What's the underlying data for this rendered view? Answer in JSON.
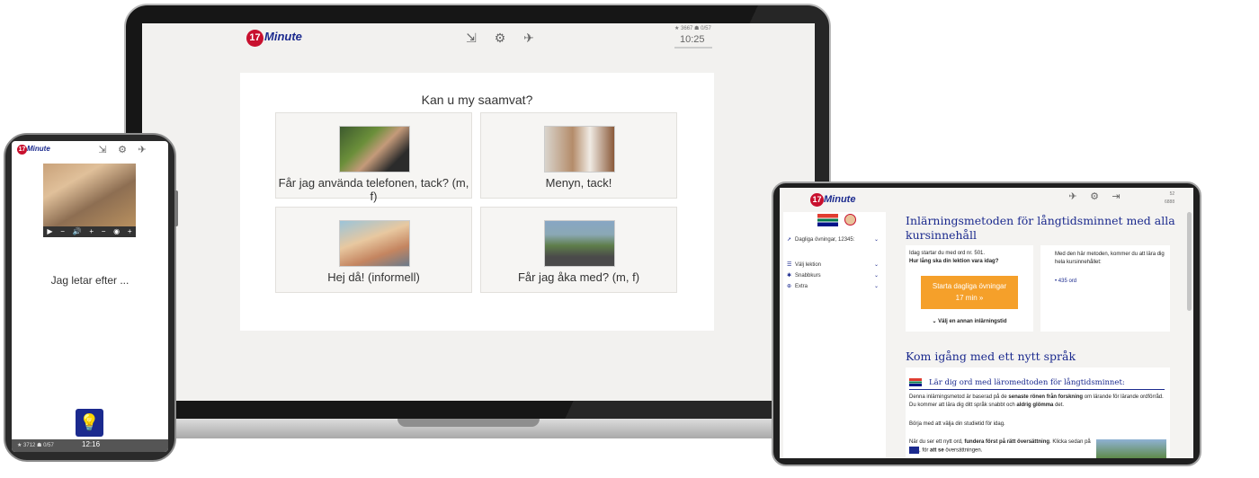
{
  "brand": {
    "logo_number": "17",
    "logo_text": "Minute"
  },
  "laptop": {
    "stats": "★ 3667 ☗ 0/57",
    "time": "10:25",
    "question": "Kan u my saamvat?",
    "options": [
      {
        "label": "Får jag använda telefonen, tack? (m, f)"
      },
      {
        "label": "Menyn, tack!"
      },
      {
        "label": "Hej då! (informell)"
      },
      {
        "label": "Får jag åka med? (m, f)"
      }
    ]
  },
  "phone": {
    "controls": [
      "▶",
      "−",
      "🔊",
      "+",
      "−",
      "◉",
      "+"
    ],
    "prompt": "Jag letar efter ...",
    "stats": "★ 3712 ☗ 0/57",
    "time": "12:16"
  },
  "tablet": {
    "stats_top": "52",
    "stats_bottom": "6888",
    "sidebar": {
      "daily": "Dagliga övningar, 12345:",
      "choose_lesson": "Välj lektion",
      "quick_courses": "Snabbkurs",
      "extra": "Extra"
    },
    "heading": "Inlärningsmetoden för långtidsminnet med alla kursinnehåll",
    "box1_text_1": "Idag startar du med ord nr. 501.",
    "box1_text_2": "Hur lång ska din lektion vara idag?",
    "start_button_line1": "Starta dagliga övningar",
    "start_button_line2": "17 min  »",
    "other_time": "Välj en annan inlärningstid",
    "box2_text": "Med den här metoden, kommer du att lära dig hela kursinnehållet:",
    "words_count": "• 435 ord",
    "heading2": "Kom igång med ett nytt språk",
    "sub_heading": "Lär dig ord med läromedtoden för långtidsminnet:",
    "para1_a": "Denna inlärningsmetod är baserad på de ",
    "para1_b": "senaste rönen från forskning",
    "para1_c": " om lärande för lärande ordförråd. Du kommer att lära dig ditt språk snabbt och ",
    "para1_d": "aldrig glömma",
    "para1_e": " det.",
    "para2": "Börja med att välja din studietid för idag.",
    "para3_a": "När du ser ett nytt ord, ",
    "para3_b": "fundera först på rätt översättning",
    "para3_c": ". Klicka sedan på",
    "para3_d": ", för ",
    "para3_e": "att se",
    "para3_f": " översättningen."
  }
}
